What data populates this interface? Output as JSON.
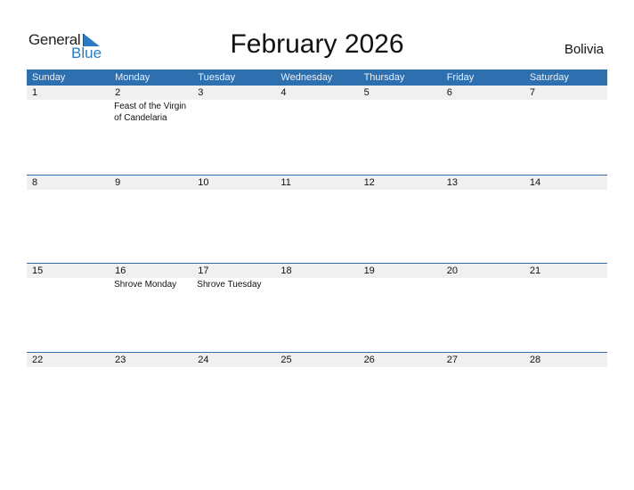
{
  "logo": {
    "part1": "General",
    "part2": "Blue"
  },
  "title": "February 2026",
  "country": "Bolivia",
  "weekdays": [
    "Sunday",
    "Monday",
    "Tuesday",
    "Wednesday",
    "Thursday",
    "Friday",
    "Saturday"
  ],
  "weeks": [
    [
      {
        "d": "1",
        "e": ""
      },
      {
        "d": "2",
        "e": "Feast of the Virgin of Candelaria"
      },
      {
        "d": "3",
        "e": ""
      },
      {
        "d": "4",
        "e": ""
      },
      {
        "d": "5",
        "e": ""
      },
      {
        "d": "6",
        "e": ""
      },
      {
        "d": "7",
        "e": ""
      }
    ],
    [
      {
        "d": "8",
        "e": ""
      },
      {
        "d": "9",
        "e": ""
      },
      {
        "d": "10",
        "e": ""
      },
      {
        "d": "11",
        "e": ""
      },
      {
        "d": "12",
        "e": ""
      },
      {
        "d": "13",
        "e": ""
      },
      {
        "d": "14",
        "e": ""
      }
    ],
    [
      {
        "d": "15",
        "e": ""
      },
      {
        "d": "16",
        "e": "Shrove Monday"
      },
      {
        "d": "17",
        "e": "Shrove Tuesday"
      },
      {
        "d": "18",
        "e": ""
      },
      {
        "d": "19",
        "e": ""
      },
      {
        "d": "20",
        "e": ""
      },
      {
        "d": "21",
        "e": ""
      }
    ],
    [
      {
        "d": "22",
        "e": ""
      },
      {
        "d": "23",
        "e": ""
      },
      {
        "d": "24",
        "e": ""
      },
      {
        "d": "25",
        "e": ""
      },
      {
        "d": "26",
        "e": ""
      },
      {
        "d": "27",
        "e": ""
      },
      {
        "d": "28",
        "e": ""
      }
    ]
  ],
  "colors": {
    "accent": "#2e6fb0",
    "logo_blue": "#2a7bc4",
    "day_bg": "#f0f0f0"
  }
}
